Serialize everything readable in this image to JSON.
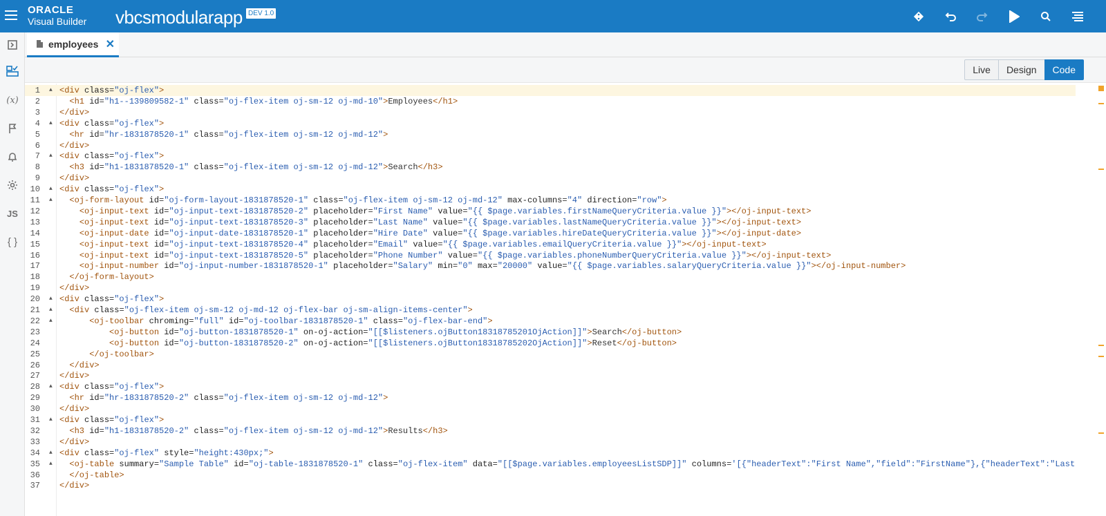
{
  "header": {
    "brand_line1": "ORACLE",
    "brand_line2": "Visual Builder",
    "app_name": "vbcsmodularapp",
    "version_badge": "DEV 1.0",
    "icons": [
      "git-icon",
      "undo-icon",
      "redo-icon",
      "run-icon",
      "search-icon",
      "menu-list-icon"
    ]
  },
  "rail": {
    "items": [
      "exit-icon",
      "structure-icon",
      "variables-icon",
      "flag-icon",
      "bell-icon",
      "gear-icon",
      "js-icon",
      "json-icon"
    ],
    "variables_label": "(x)",
    "js_label": "JS",
    "json_label": "{ }"
  },
  "tabs": [
    {
      "label": "employees",
      "close": "✕"
    }
  ],
  "modes": {
    "live": "Live",
    "design": "Design",
    "code": "Code",
    "selected": "Code"
  },
  "editor": {
    "lines": [
      "<div class=\"oj-flex\">",
      "  <h1 id=\"h1--139809582-1\" class=\"oj-flex-item oj-sm-12 oj-md-10\">Employees</h1>",
      "</div>",
      "<div class=\"oj-flex\">",
      "  <hr id=\"hr-1831878520-1\" class=\"oj-flex-item oj-sm-12 oj-md-12\">",
      "</div>",
      "<div class=\"oj-flex\">",
      "  <h3 id=\"h1-1831878520-1\" class=\"oj-flex-item oj-sm-12 oj-md-12\">Search</h3>",
      "</div>",
      "<div class=\"oj-flex\">",
      "  <oj-form-layout id=\"oj-form-layout-1831878520-1\" class=\"oj-flex-item oj-sm-12 oj-md-12\" max-columns=\"4\" direction=\"row\">",
      "    <oj-input-text id=\"oj-input-text-1831878520-2\" placeholder=\"First Name\" value=\"{{ $page.variables.firstNameQueryCriteria.value }}\"></oj-input-text>",
      "    <oj-input-text id=\"oj-input-text-1831878520-3\" placeholder=\"Last Name\" value=\"{{ $page.variables.lastNameQueryCriteria.value }}\"></oj-input-text>",
      "    <oj-input-date id=\"oj-input-date-1831878520-1\" placeholder=\"Hire Date\" value=\"{{ $page.variables.hireDateQueryCriteria.value }}\"></oj-input-date>",
      "    <oj-input-text id=\"oj-input-text-1831878520-4\" placeholder=\"Email\" value=\"{{ $page.variables.emailQueryCriteria.value }}\"></oj-input-text>",
      "    <oj-input-text id=\"oj-input-text-1831878520-5\" placeholder=\"Phone Number\" value=\"{{ $page.variables.phoneNumberQueryCriteria.value }}\"></oj-input-text>",
      "    <oj-input-number id=\"oj-input-number-1831878520-1\" placeholder=\"Salary\" min=\"0\" max=\"20000\" value=\"{{ $page.variables.salaryQueryCriteria.value }}\"></oj-input-number>",
      "  </oj-form-layout>",
      "</div>",
      "<div class=\"oj-flex\">",
      "  <div class=\"oj-flex-item oj-sm-12 oj-md-12 oj-flex-bar oj-sm-align-items-center\">",
      "      <oj-toolbar chroming=\"full\" id=\"oj-toolbar-1831878520-1\" class=\"oj-flex-bar-end\">",
      "          <oj-button id=\"oj-button-1831878520-1\" on-oj-action=\"[[$listeners.ojButton18318785201OjAction]]\">Search</oj-button>",
      "          <oj-button id=\"oj-button-1831878520-2\" on-oj-action=\"[[$listeners.ojButton18318785202OjAction]]\">Reset</oj-button>",
      "      </oj-toolbar>",
      "  </div>",
      "</div>",
      "<div class=\"oj-flex\">",
      "  <hr id=\"hr-1831878520-2\" class=\"oj-flex-item oj-sm-12 oj-md-12\">",
      "</div>",
      "<div class=\"oj-flex\">",
      "  <h3 id=\"h1-1831878520-2\" class=\"oj-flex-item oj-sm-12 oj-md-12\">Results</h3>",
      "</div>",
      "<div class=\"oj-flex\" style=\"height:430px;\">",
      "  <oj-table summary=\"Sample Table\" id=\"oj-table-1831878520-1\" class=\"oj-flex-item\" data=\"[[$page.variables.employeesListSDP]]\" columns='[{\"headerText\":\"First Name\",\"field\":\"FirstName\"},{\"headerText\":\"Last",
      "  </oj-table>",
      "</div>"
    ],
    "fold_lines": [
      1,
      4,
      7,
      10,
      11,
      20,
      21,
      22,
      28,
      31,
      34,
      35
    ],
    "current_line": 1
  },
  "colors": {
    "header": "#1a7bc4",
    "tag": "#a1540d",
    "value": "#2a5db0",
    "scroll_marker": "#f0a32a"
  }
}
